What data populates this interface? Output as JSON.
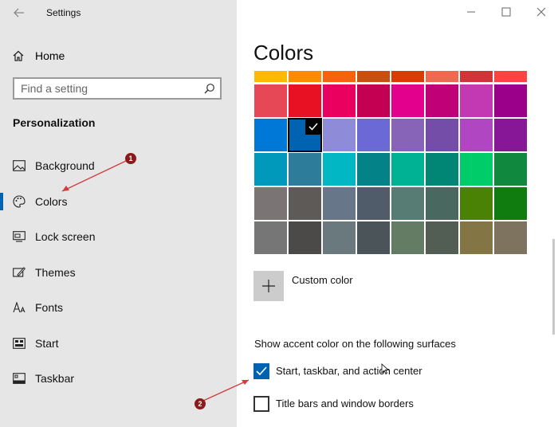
{
  "window": {
    "title": "Settings",
    "controls": {
      "minimize": "minimize-icon",
      "maximize": "maximize-icon",
      "close": "close-icon"
    }
  },
  "sidebar": {
    "home_label": "Home",
    "search_placeholder": "Find a setting",
    "section_title": "Personalization",
    "items": [
      {
        "label": "Background",
        "icon": "picture-icon",
        "selected": false
      },
      {
        "label": "Colors",
        "icon": "palette-icon",
        "selected": true
      },
      {
        "label": "Lock screen",
        "icon": "lock-screen-icon",
        "selected": false
      },
      {
        "label": "Themes",
        "icon": "themes-icon",
        "selected": false
      },
      {
        "label": "Fonts",
        "icon": "fonts-icon",
        "selected": false
      },
      {
        "label": "Start",
        "icon": "start-icon",
        "selected": false
      },
      {
        "label": "Taskbar",
        "icon": "taskbar-icon",
        "selected": false
      }
    ]
  },
  "main": {
    "title": "Colors",
    "swatches": [
      [
        "#ffb900",
        "#ff8c00",
        "#f7630c",
        "#ca5010",
        "#da3b01",
        "#ef6950",
        "#d13438",
        "#ff4343"
      ],
      [
        "#e74856",
        "#e81123",
        "#ea005e",
        "#c30052",
        "#e3008c",
        "#bf0077",
        "#c239b3",
        "#9a0089"
      ],
      [
        "#0078d7",
        "#0063b1",
        "#8e8cd8",
        "#6b69d6",
        "#8764b8",
        "#744da9",
        "#b146c2",
        "#881798"
      ],
      [
        "#0099bc",
        "#2d7d9a",
        "#00b7c3",
        "#038387",
        "#00b294",
        "#018574",
        "#00cc6a",
        "#10893e"
      ],
      [
        "#7a7574",
        "#5d5a58",
        "#68768a",
        "#515c6b",
        "#567c73",
        "#486860",
        "#498205",
        "#107c10"
      ],
      [
        "#767676",
        "#4c4a48",
        "#69797e",
        "#4a5459",
        "#647c64",
        "#525e54",
        "#847545",
        "#7e735f"
      ]
    ],
    "selected_swatch": {
      "row": 2,
      "col": 1
    },
    "custom_color_label": "Custom color",
    "accent_label": "Show accent color on the following surfaces",
    "checkboxes": [
      {
        "label": "Start, taskbar, and action center",
        "checked": true
      },
      {
        "label": "Title bars and window borders",
        "checked": false
      }
    ]
  },
  "annotations": [
    "1",
    "2"
  ],
  "colors": {
    "accent": "#0063b1",
    "annotation": "#8b1a1a",
    "sidebar_bg": "#e6e6e6"
  }
}
